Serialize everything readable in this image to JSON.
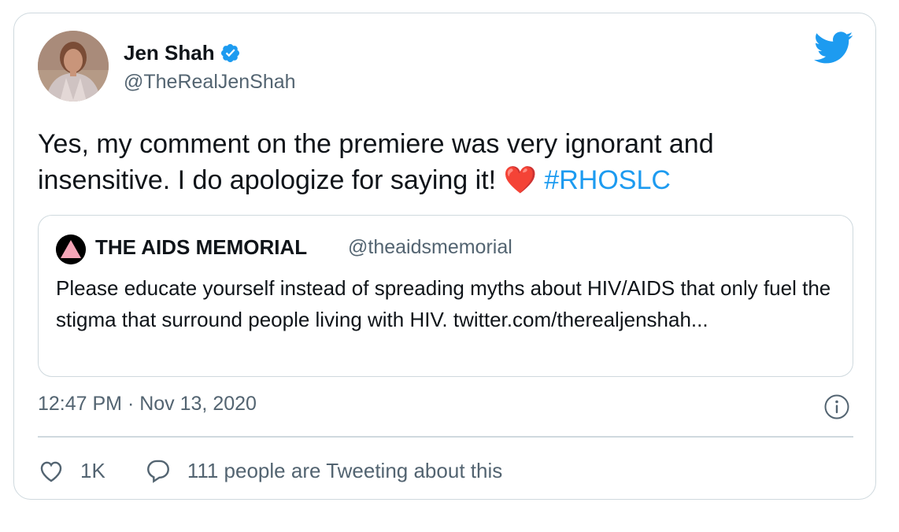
{
  "tweet": {
    "author_name": "Jen Shah",
    "author_handle": "@TheRealJenShah",
    "text_main": "Yes, my comment on the premiere was very ignorant and insensitive. I do apologize for saying it! ",
    "heart_emoji": "❤️",
    "hashtag": "#RHOSLC",
    "timestamp": "12:47 PM · Nov 13, 2020",
    "likes_count": "1K",
    "tweeting_about": "111 people are Tweeting about this"
  },
  "quoted": {
    "author_name": "THE AIDS MEMORIAL",
    "author_handle": "@theaidsmemorial",
    "text": "Please educate yourself instead of spreading myths about HIV/AIDS that only fuel the stigma that surround people living with HIV. twitter.com/therealjenshah..."
  },
  "colors": {
    "accent": "#1d9bf0",
    "muted": "#536471",
    "border": "#cfd9de",
    "heart": "#d0021b"
  },
  "icons": {
    "verified": "verified-badge-icon",
    "brand": "twitter-bird-icon",
    "info": "info-icon",
    "like": "heart-outline-icon",
    "reply": "speech-bubble-icon"
  }
}
